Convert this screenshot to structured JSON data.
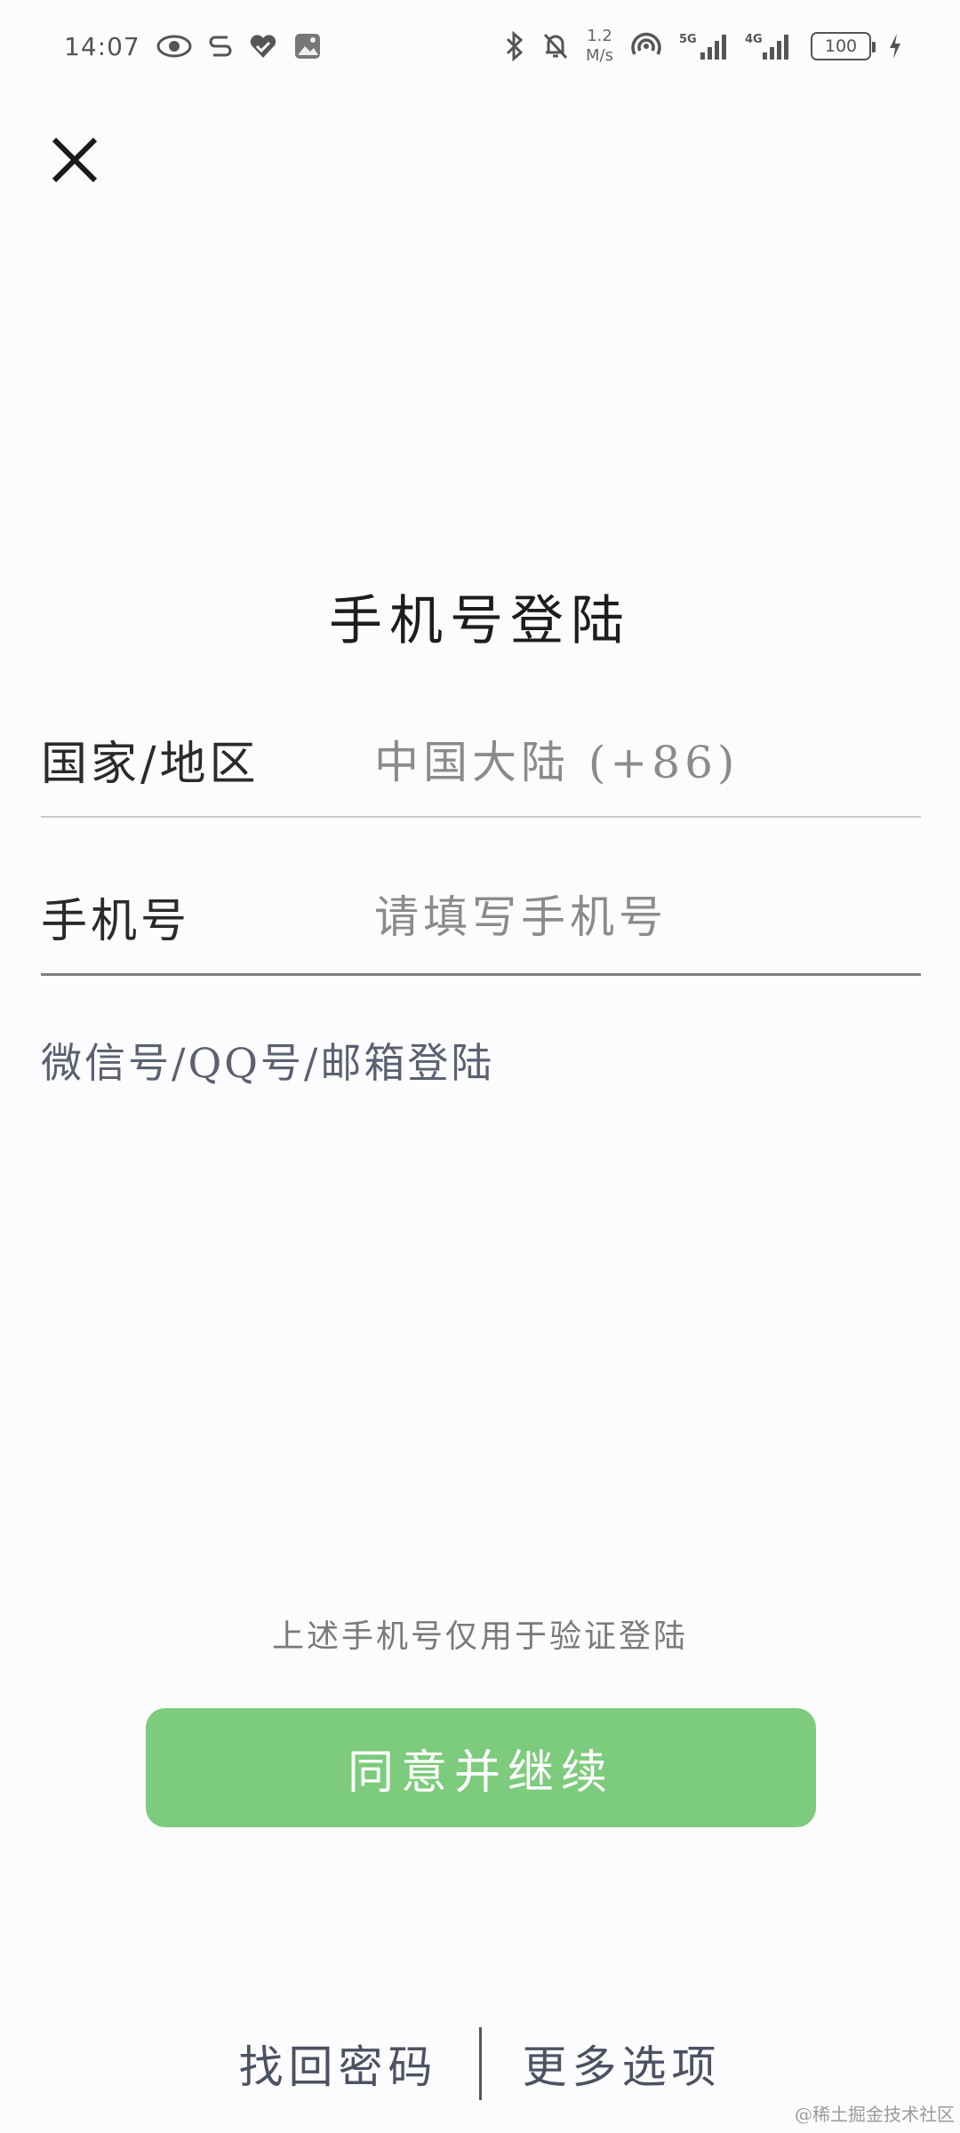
{
  "status_bar": {
    "time": "14:07",
    "net_speed_value": "1.2",
    "net_speed_unit": "M/s",
    "sim1_label": "5G",
    "sim2_label": "4G",
    "battery_level": "100",
    "icons": [
      "eye-icon",
      "s-app-icon",
      "heart-icon",
      "image-icon",
      "bluetooth-icon",
      "bell-muted-icon",
      "hotspot-icon",
      "signal-icon",
      "battery-icon",
      "charging-icon"
    ]
  },
  "header": {
    "title": "手机号登陆"
  },
  "form": {
    "country_label": "国家/地区",
    "country_value": "中国大陆 (+86)",
    "phone_label": "手机号",
    "phone_placeholder": "请填写手机号",
    "phone_value": ""
  },
  "alt_login": {
    "label": "微信号/QQ号/邮箱登陆"
  },
  "footer": {
    "notice": "上述手机号仅用于验证登陆",
    "continue_label": "同意并继续",
    "links": [
      {
        "label": "找回密码"
      },
      {
        "label": "更多选项"
      }
    ]
  },
  "watermark": "@稀土掘金技术社区",
  "colors": {
    "primary_button": "#7dcb7d",
    "background": "#fcfbfd"
  }
}
